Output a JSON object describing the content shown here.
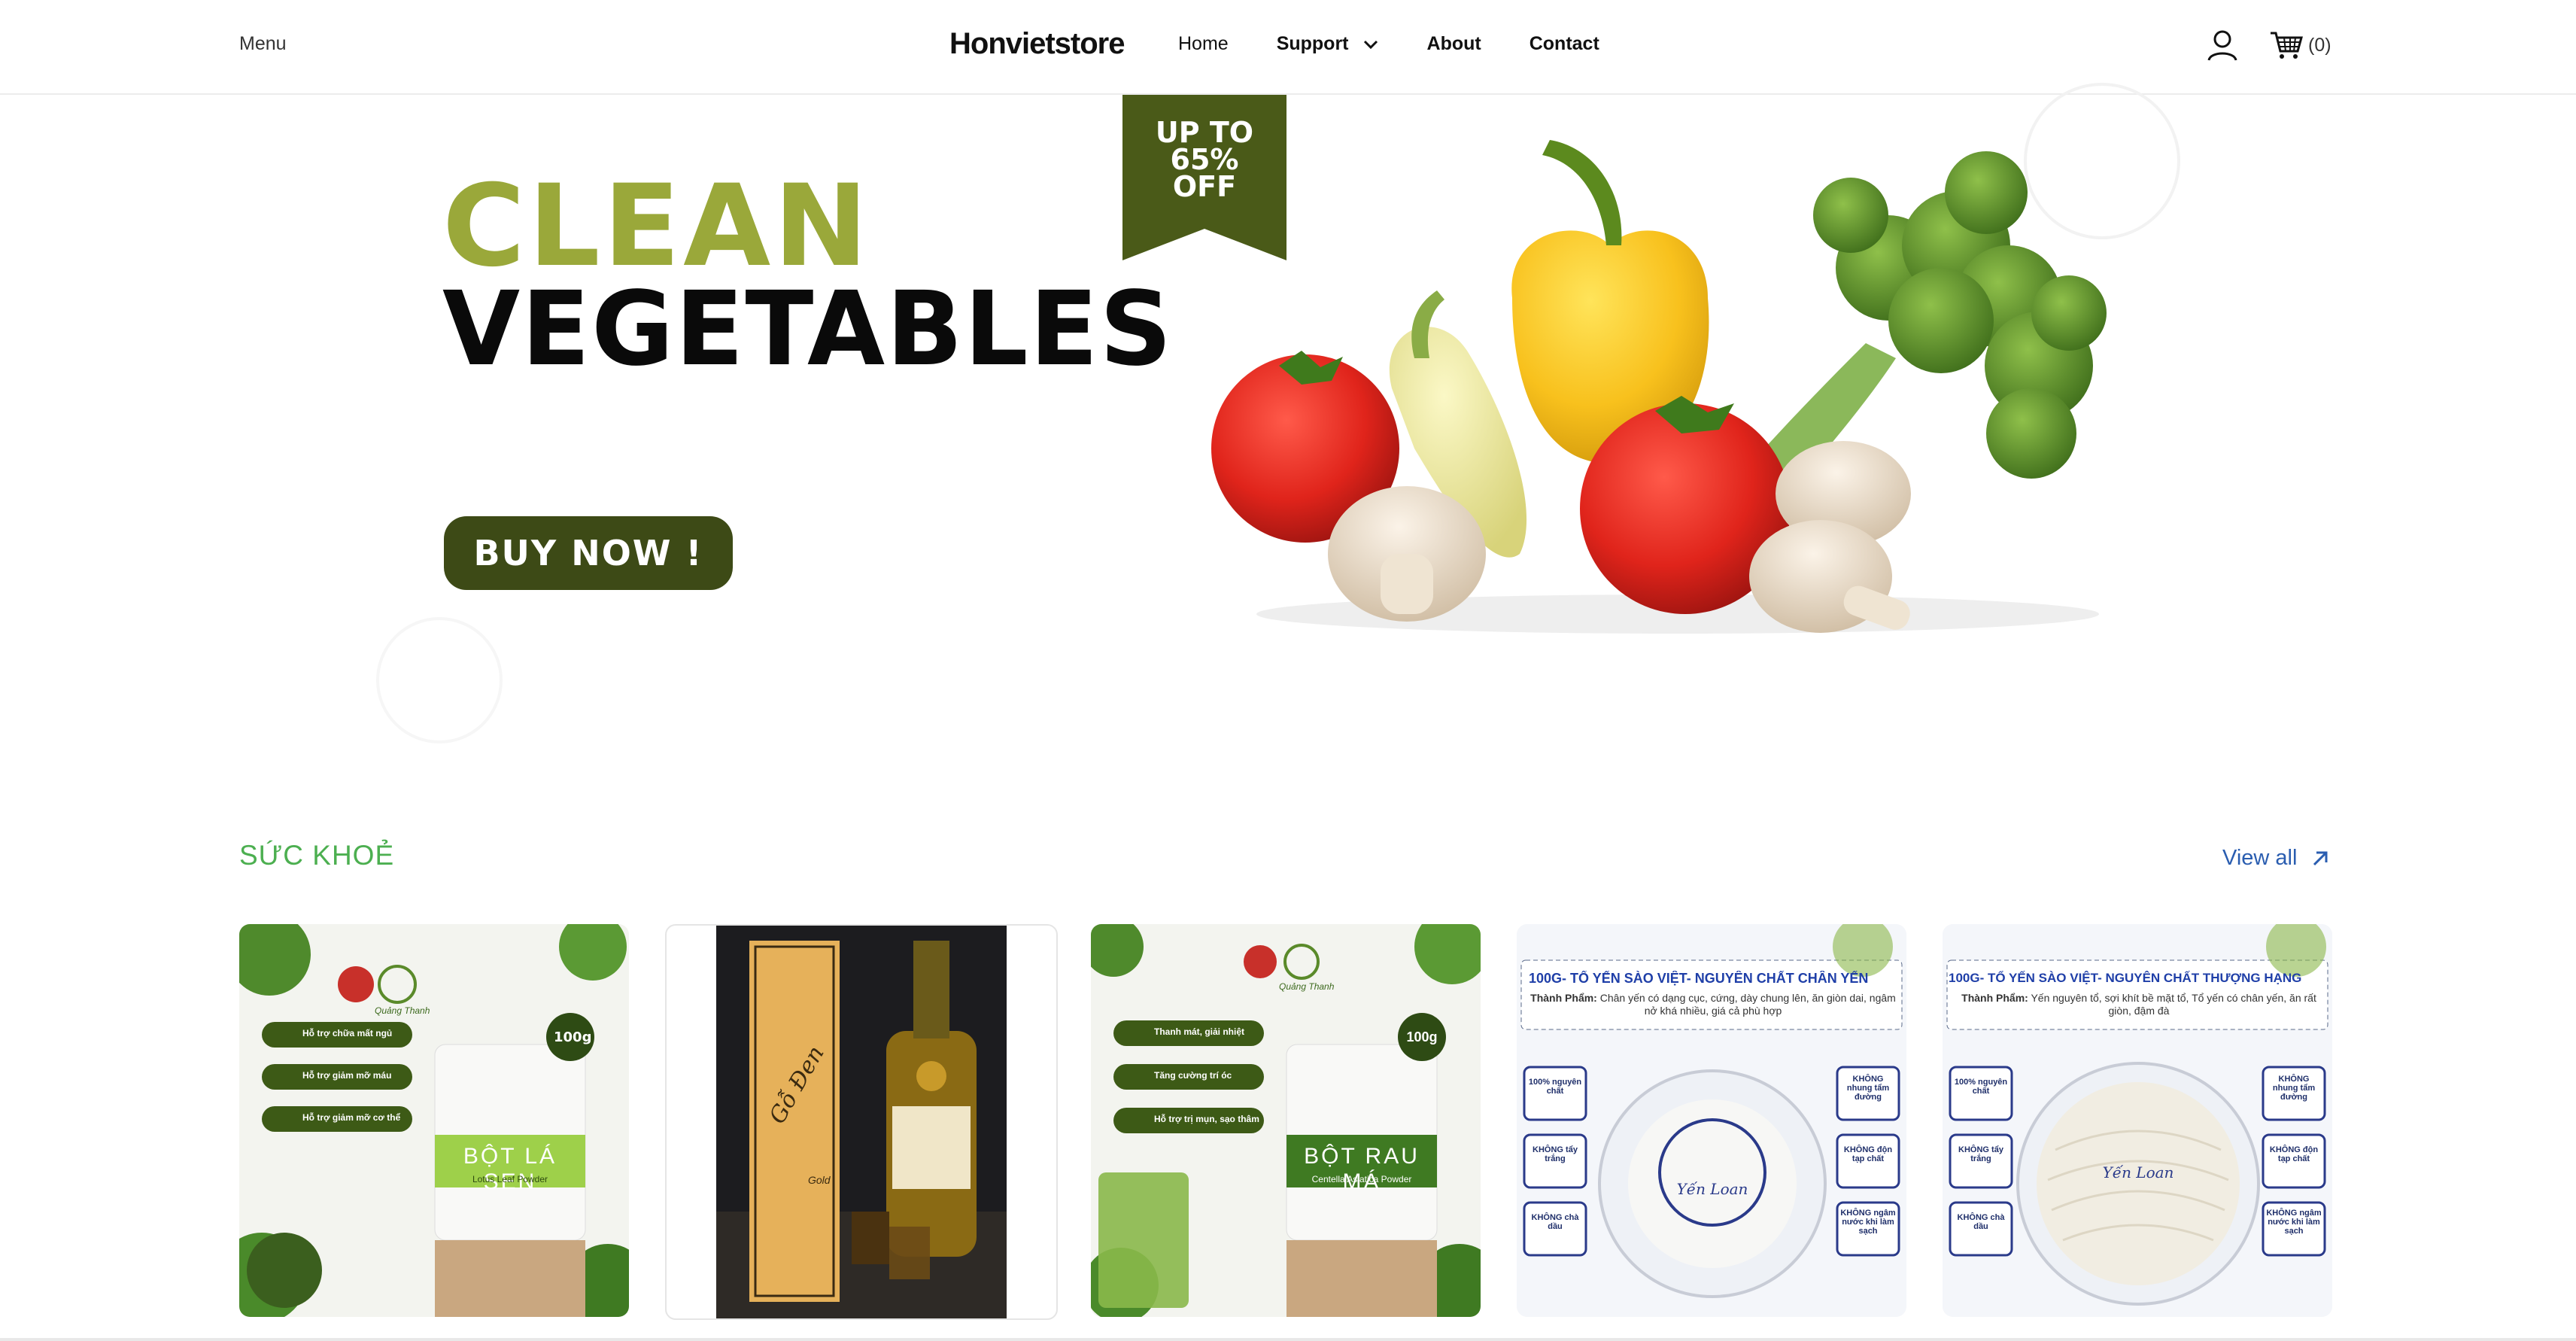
{
  "header": {
    "menu_label": "Menu",
    "brand": "Honvietstore",
    "nav": [
      {
        "label": "Home"
      },
      {
        "label": "Support"
      },
      {
        "label": "About"
      },
      {
        "label": "Contact"
      }
    ],
    "cart_count": "(0)"
  },
  "hero": {
    "title_line1": "CLEAN",
    "title_line2": "VEGETABLES",
    "badge_lines": [
      "UP TO",
      "65%",
      "OFF"
    ],
    "cta": "BUY NOW !",
    "colors": {
      "accent_green": "#9aa83a",
      "dark_olive": "#3d4a16"
    }
  },
  "section": {
    "title": "SỨC KHOẺ",
    "view_all": "View all"
  },
  "products": [
    {
      "name": "BỘT LÁ SEN",
      "subtitle": "Lotus Leaf Powder",
      "weight": "100g",
      "brand": "Quảng Thanh",
      "benefits": [
        "Hỗ trợ chữa mất ngủ",
        "Hỗ trợ giảm mỡ máu",
        "Hỗ trợ giảm mỡ cơ thể"
      ]
    },
    {
      "name": "Gỗ Đen",
      "subtitle": "Gold"
    },
    {
      "name": "BỘT RAU MÁ",
      "subtitle": "Centella Asiatica Powder",
      "weight": "100g",
      "brand": "Quảng Thanh",
      "benefits": [
        "Thanh mát, giải nhiệt",
        "Tăng cường trí óc",
        "Hỗ trợ trị mụn, sạo thâm"
      ]
    },
    {
      "headline": "100G- TỔ YẾN SÀO VIỆT- NGUYÊN CHẤT CHÂN YẾN",
      "desc_label": "Thành Phẩm:",
      "desc": "Chân yến có dạng cục, cứng, dày chung lên, ăn giòn dai, ngâm nở khá nhiều, giá cả phù hợp",
      "brand": "Yến Loan",
      "left_badges": [
        "100% nguyên chất",
        "KHÔNG tẩy trắng",
        "KHÔNG chà dầu"
      ],
      "right_badges": [
        "KHÔNG nhung tẩm đường",
        "KHÔNG độn tạp chất",
        "KHÔNG ngâm nước khi làm sạch"
      ]
    },
    {
      "headline": "100G- TỔ YẾN SÀO VIỆT- NGUYÊN CHẤT THƯỢNG HẠNG",
      "desc_label": "Thành Phẩm:",
      "desc": "Yến nguyên tổ, sợi khít bề mặt tổ, Tổ yến có chân yến, ăn rất giòn, đậm đà",
      "brand": "Yến Loan",
      "left_badges": [
        "100% nguyên chất",
        "KHÔNG tẩy trắng",
        "KHÔNG chà dầu"
      ],
      "right_badges": [
        "KHÔNG nhung tẩm đường",
        "KHÔNG độn tạp chất",
        "KHÔNG ngâm nước khi làm sạch"
      ]
    }
  ]
}
